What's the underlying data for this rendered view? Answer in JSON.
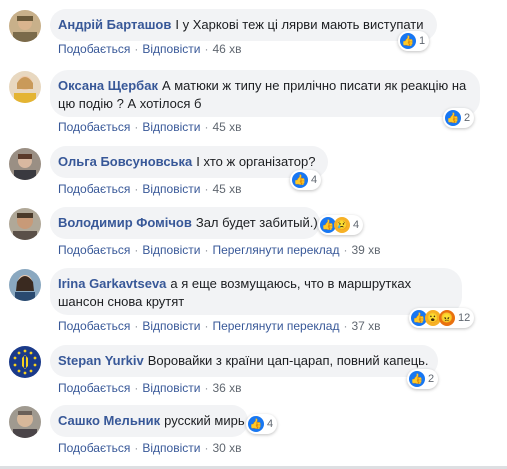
{
  "comments": [
    {
      "name": "Андрій Барташов",
      "text": "І у Харкові теж ці лярви мають виступати",
      "like": "Подобається",
      "reply": "Відповісти",
      "time": "46 хв",
      "reactions": "1"
    },
    {
      "name": "Оксана Щербак",
      "text": "А матюки ж типу не прилічно писати як реакцію на цю подію ? А хотілося б",
      "like": "Подобається",
      "reply": "Відповісти",
      "time": "45 хв",
      "reactions": "2"
    },
    {
      "name": "Ольга Бовсуновська",
      "text": "І хто ж організатор?",
      "like": "Подобається",
      "reply": "Відповісти",
      "time": "45 хв",
      "reactions": "4"
    },
    {
      "name": "Володимир Фомічов",
      "text": "Зал будет забитый.)",
      "like": "Подобається",
      "reply": "Відповісти",
      "translate": "Переглянути переклад",
      "time": "39 хв",
      "reactions": "4"
    },
    {
      "name": "Irina Garkavtseva",
      "text": "а я еще возмущаюсь, что в маршрутках шансон снова крутят",
      "like": "Подобається",
      "reply": "Відповісти",
      "translate": "Переглянути переклад",
      "time": "37 хв",
      "reactions": "12"
    },
    {
      "name": "Stepan Yurkiv",
      "text": "Воровайки з країни цап-царап, повний капець.",
      "like": "Подобається",
      "reply": "Відповісти",
      "time": "36 хв",
      "reactions": "2"
    },
    {
      "name": "Сашко Мельник",
      "text": "русский мирь",
      "like": "Подобається",
      "reply": "Відповісти",
      "time": "30 хв",
      "reactions": "4"
    }
  ],
  "colors": {
    "link": "#385898",
    "bubble": "#f2f3f5",
    "like": "#1877f2"
  }
}
